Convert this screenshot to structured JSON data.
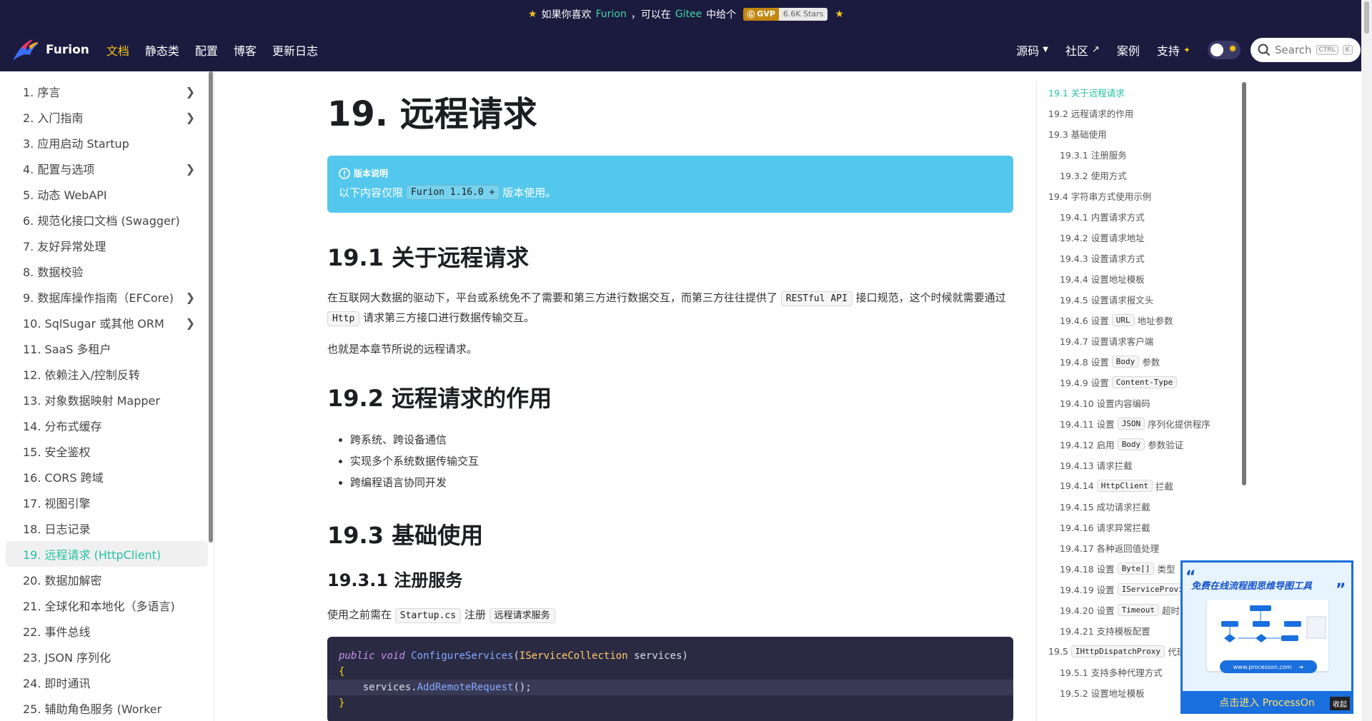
{
  "announcement": {
    "prefix": "如果你喜欢",
    "link1": "Furion",
    "middle": "，可以在",
    "link2": "Gitee",
    "suffix": "中给个",
    "badge_left": "GVP",
    "badge_right": "6.6K Stars"
  },
  "navbar": {
    "brand": "Furion",
    "links": [
      "文档",
      "静态类",
      "配置",
      "博客",
      "更新日志"
    ],
    "right_links": [
      "源码",
      "社区",
      "案例",
      "支持"
    ],
    "search_placeholder": "Search",
    "kbd1": "CTRL",
    "kbd2": "K",
    "colors": {
      "bg": "#1b1a3f",
      "active": "#f5c518"
    }
  },
  "sidebar": {
    "items": [
      {
        "label": "1. 序言",
        "expandable": true
      },
      {
        "label": "2. 入门指南",
        "expandable": true
      },
      {
        "label": "3. 应用启动 Startup",
        "expandable": false
      },
      {
        "label": "4. 配置与选项",
        "expandable": true
      },
      {
        "label": "5. 动态 WebAPI",
        "expandable": false
      },
      {
        "label": "6. 规范化接口文档 (Swagger)",
        "expandable": false
      },
      {
        "label": "7. 友好异常处理",
        "expandable": false
      },
      {
        "label": "8. 数据校验",
        "expandable": false
      },
      {
        "label": "9. 数据库操作指南（EFCore)",
        "expandable": true
      },
      {
        "label": "10. SqlSugar 或其他 ORM",
        "expandable": true
      },
      {
        "label": "11. SaaS 多租户",
        "expandable": false
      },
      {
        "label": "12. 依赖注入/控制反转",
        "expandable": false
      },
      {
        "label": "13. 对象数据映射 Mapper",
        "expandable": false
      },
      {
        "label": "14. 分布式缓存",
        "expandable": false
      },
      {
        "label": "15. 安全鉴权",
        "expandable": false
      },
      {
        "label": "16. CORS 跨域",
        "expandable": false
      },
      {
        "label": "17. 视图引擎",
        "expandable": false
      },
      {
        "label": "18. 日志记录",
        "expandable": false
      },
      {
        "label": "19. 远程请求 (HttpClient)",
        "expandable": false,
        "active": true
      },
      {
        "label": "20. 数据加解密",
        "expandable": false
      },
      {
        "label": "21. 全球化和本地化（多语言)",
        "expandable": false
      },
      {
        "label": "22. 事件总线",
        "expandable": false
      },
      {
        "label": "23. JSON 序列化",
        "expandable": false
      },
      {
        "label": "24. 即时通讯",
        "expandable": false
      },
      {
        "label": "25. 辅助角色服务 (Worker",
        "expandable": false
      }
    ]
  },
  "main": {
    "title": "19. 远程请求",
    "admonition": {
      "heading": "版本说明",
      "before": "以下内容仅限",
      "code": "Furion 1.16.0 +",
      "after": "版本使用。"
    },
    "s1_title": "19.1 关于远程请求",
    "s1_p1_a": "在互联网大数据的驱动下，平台或系统免不了需要和第三方进行数据交互，而第三方往往提供了",
    "s1_p1_code1": "RESTful API",
    "s1_p1_b": "接口规范，这个时候就需要通过",
    "s1_p1_code2": "Http",
    "s1_p1_c": "请求第三方接口进行数据传输交互。",
    "s1_p2": "也就是本章节所说的远程请求。",
    "s2_title": "19.2 远程请求的作用",
    "s2_bullets": [
      "跨系统、跨设备通信",
      "实现多个系统数据传输交互",
      "跨编程语言协同开发"
    ],
    "s3_title": "19.3 基础使用",
    "s31_title": "19.3.1 注册服务",
    "s31_p_a": "使用之前需在",
    "s31_p_code1": "Startup.cs",
    "s31_p_b": "注册",
    "s31_p_code2": "远程请求服务",
    "code": {
      "l1_kw1": "public",
      "l1_kw2": "void",
      "l1_fn": "ConfigureServices",
      "l1_type": "IServiceCollection",
      "l1_param": "services",
      "l2": "{",
      "l3_obj": "services",
      "l3_fn": "AddRemoteRequest",
      "l4": "}"
    }
  },
  "toc": {
    "items": [
      {
        "label": "19.1 关于远程请求",
        "level": 1,
        "active": true
      },
      {
        "label": "19.2 远程请求的作用",
        "level": 1
      },
      {
        "label": "19.3 基础使用",
        "level": 1
      },
      {
        "label": "19.3.1 注册服务",
        "level": 2
      },
      {
        "label": "19.3.2 使用方式",
        "level": 2
      },
      {
        "label": "19.4 字符串方式使用示例",
        "level": 1
      },
      {
        "label": "19.4.1 内置请求方式",
        "level": 2
      },
      {
        "label": "19.4.2 设置请求地址",
        "level": 2
      },
      {
        "label": "19.4.3 设置请求方式",
        "level": 2
      },
      {
        "label": "19.4.4 设置地址模板",
        "level": 2
      },
      {
        "label": "19.4.5 设置请求报文头",
        "level": 2
      },
      {
        "label": "19.4.6 设置",
        "code": "URL",
        "after": "地址参数",
        "level": 2
      },
      {
        "label": "19.4.7 设置请求客户端",
        "level": 2
      },
      {
        "label": "19.4.8 设置",
        "code": "Body",
        "after": "参数",
        "level": 2
      },
      {
        "label": "19.4.9 设置",
        "code": "Content-Type",
        "after": "",
        "level": 2
      },
      {
        "label": "19.4.10 设置内容编码",
        "level": 2
      },
      {
        "label": "19.4.11 设置",
        "code": "JSON",
        "after": "序列化提供程序",
        "level": 2
      },
      {
        "label": "19.4.12 启用",
        "code": "Body",
        "after": "参数验证",
        "level": 2
      },
      {
        "label": "19.4.13 请求拦截",
        "level": 2
      },
      {
        "label": "19.4.14",
        "code": "HttpClient",
        "after": "拦截",
        "level": 2
      },
      {
        "label": "19.4.15 成功请求拦截",
        "level": 2
      },
      {
        "label": "19.4.16 请求异常拦截",
        "level": 2
      },
      {
        "label": "19.4.17 各种返回值处理",
        "level": 2
      },
      {
        "label": "19.4.18 设置",
        "code": "Byte[]",
        "after": "类型",
        "level": 2
      },
      {
        "label": "19.4.19 设置",
        "code": "IServiceProvi",
        "after": "",
        "level": 2
      },
      {
        "label": "19.4.20 设置",
        "code": "Timeout",
        "after": "超时时",
        "level": 2
      },
      {
        "label": "19.4.21 支持模板配置",
        "level": 2
      },
      {
        "label": "19.5",
        "code": "IHttpDispatchProxy",
        "after": "代理",
        "level": 1
      },
      {
        "label": "19.5.1 支持多种代理方式",
        "level": 2
      },
      {
        "label": "19.5.2 设置地址模板",
        "level": 2
      }
    ]
  },
  "ad": {
    "title": "免费在线流程图思维导图工具",
    "url": "www.processon.com",
    "cta": "点击进入 ProcessOn",
    "close": "收起"
  }
}
